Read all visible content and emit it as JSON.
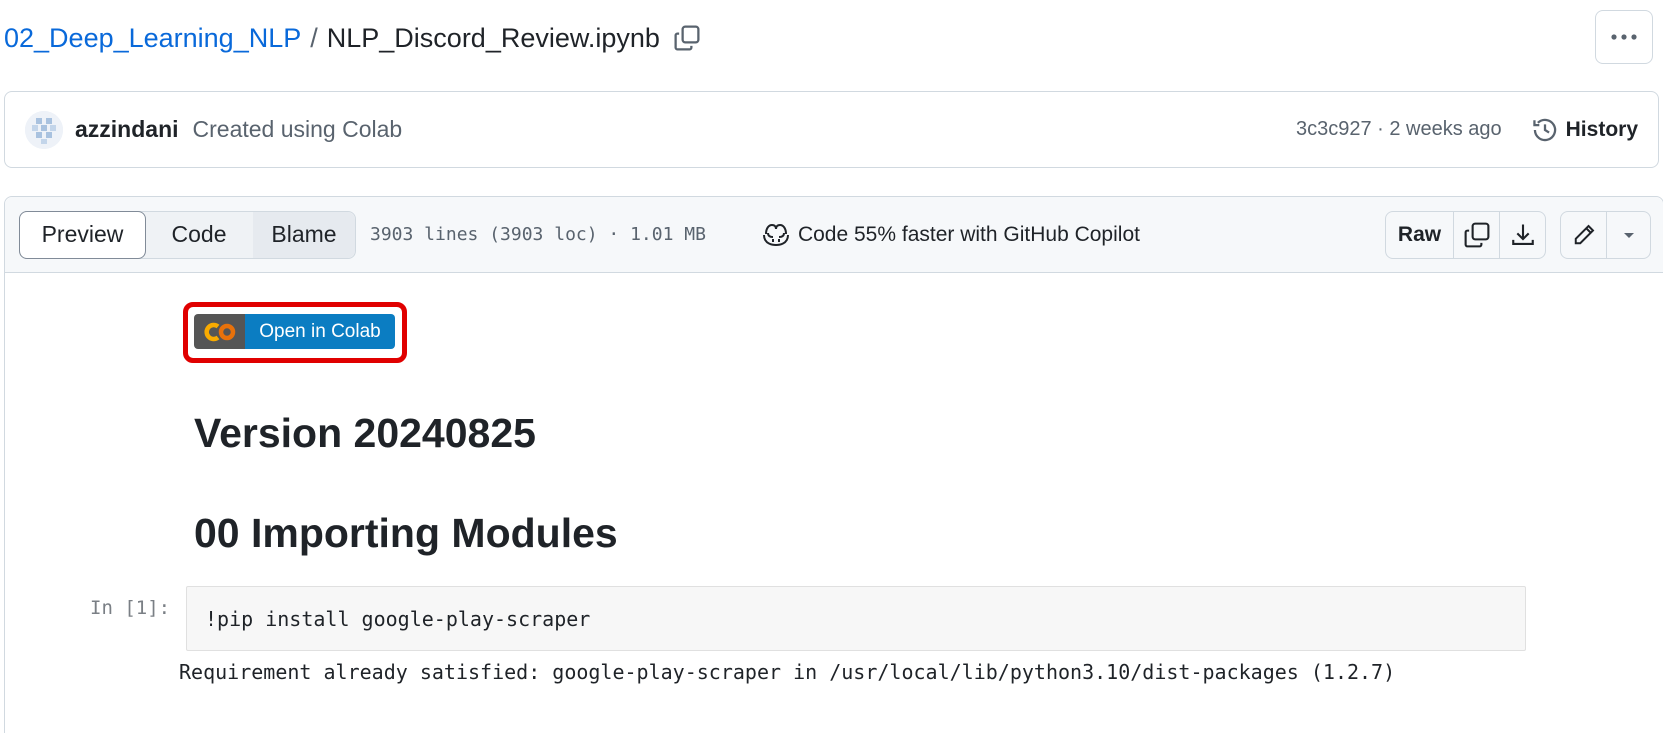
{
  "breadcrumb": {
    "folder": "02_Deep_Learning_NLP",
    "separator": "/",
    "file": "NLP_Discord_Review.ipynb"
  },
  "commit": {
    "author": "azzindani",
    "message": "Created using Colab",
    "meta": "3c3c927 · 2 weeks ago",
    "history_label": "History"
  },
  "file_header": {
    "tabs": [
      {
        "label": "Preview",
        "active": true
      },
      {
        "label": "Code",
        "active": false
      },
      {
        "label": "Blame",
        "active": false
      }
    ],
    "stats": "3903 lines (3903 loc) · 1.01 MB",
    "copilot_label": "Code 55% faster with GitHub Copilot",
    "raw_label": "Raw"
  },
  "notebook": {
    "badge_label": "Open in Colab",
    "heading_version": "Version 20240825",
    "heading_import": "00 Importing Modules",
    "cell_prompt": "In [1]:",
    "cell_code": "!pip install google-play-scraper",
    "cell_output": "Requirement already satisfied: google-play-scraper in /usr/local/lib/python3.10/dist-packages (1.2.7)"
  },
  "colors": {
    "link": "#0969da",
    "highlight": "#e00000",
    "colab_blue": "#0b7dc2",
    "colab_orange": "#f9ab00"
  }
}
